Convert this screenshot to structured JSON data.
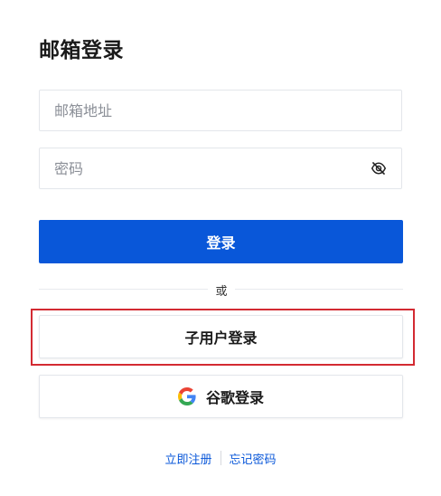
{
  "page": {
    "title": "邮箱登录"
  },
  "form": {
    "email_placeholder": "邮箱地址",
    "email_value": "",
    "password_placeholder": "密码",
    "password_value": "",
    "password_toggle_icon": "eye-slash-icon",
    "login_label": "登录"
  },
  "divider": {
    "text": "或"
  },
  "alternatives": {
    "subuser_label": "子用户登录",
    "google_label": "谷歌登录",
    "google_icon": "google-icon"
  },
  "footer": {
    "register_link": "立即注册",
    "forgot_link": "忘记密码"
  },
  "colors": {
    "primary": "#0957d9",
    "highlight_border": "#d32a32",
    "border": "#e3e6eb"
  }
}
